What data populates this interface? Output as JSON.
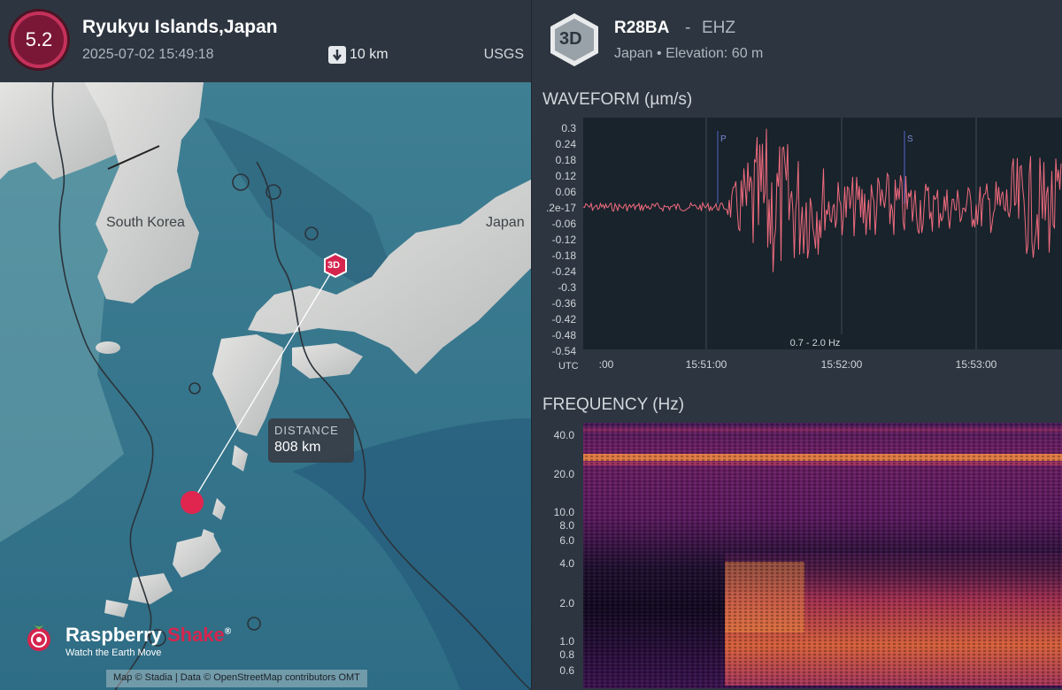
{
  "event": {
    "magnitude": "5.2",
    "location": "Ryukyu Islands,Japan",
    "datetime": "2025-07-02 15:49:18",
    "depth": "10 km",
    "source": "USGS"
  },
  "map": {
    "labels": {
      "korea": "South Korea",
      "japan": "Japan"
    },
    "station_marker": "3D",
    "distance_label": "DISTANCE",
    "distance_value": "808 km",
    "logo": {
      "name_a": "Raspberry",
      "name_b": "Shake",
      "mark": "®",
      "tagline": "Watch the Earth Move"
    },
    "attribution": "Map © Stadia | Data © OpenStreetMap contributors  OMT"
  },
  "station": {
    "badge": "3D",
    "code": "R28BA",
    "separator": "-",
    "channel": "EHZ",
    "meta": "Japan • Elevation: 60 m"
  },
  "waveform": {
    "title": "WAVEFORM (µm/s)",
    "filter": "0.7 - 2.0 Hz",
    "utc_label": "UTC",
    "y_ticks": [
      "0.3",
      "0.24",
      "0.18",
      "0.12",
      "0.06",
      ".2e-17",
      "-0.06",
      "-0.12",
      "-0.18",
      "-0.24",
      "-0.3",
      "-0.36",
      "-0.42",
      "-0.48",
      "-0.54"
    ],
    "x_ticks": [
      ":00",
      "15:51:00",
      "15:52:00",
      "15:53:00"
    ],
    "phases": [
      "P",
      "S"
    ],
    "colors": {
      "trace": "#f06b7e",
      "bg": "#18232b",
      "phase": "#4a5ab0"
    }
  },
  "frequency": {
    "title": "FREQUENCY (Hz)",
    "y_ticks": [
      "40.0",
      "20.0",
      "10.0",
      "8.0",
      "6.0",
      "4.0",
      "2.0",
      "1.0",
      "0.8",
      "0.6"
    ]
  }
}
